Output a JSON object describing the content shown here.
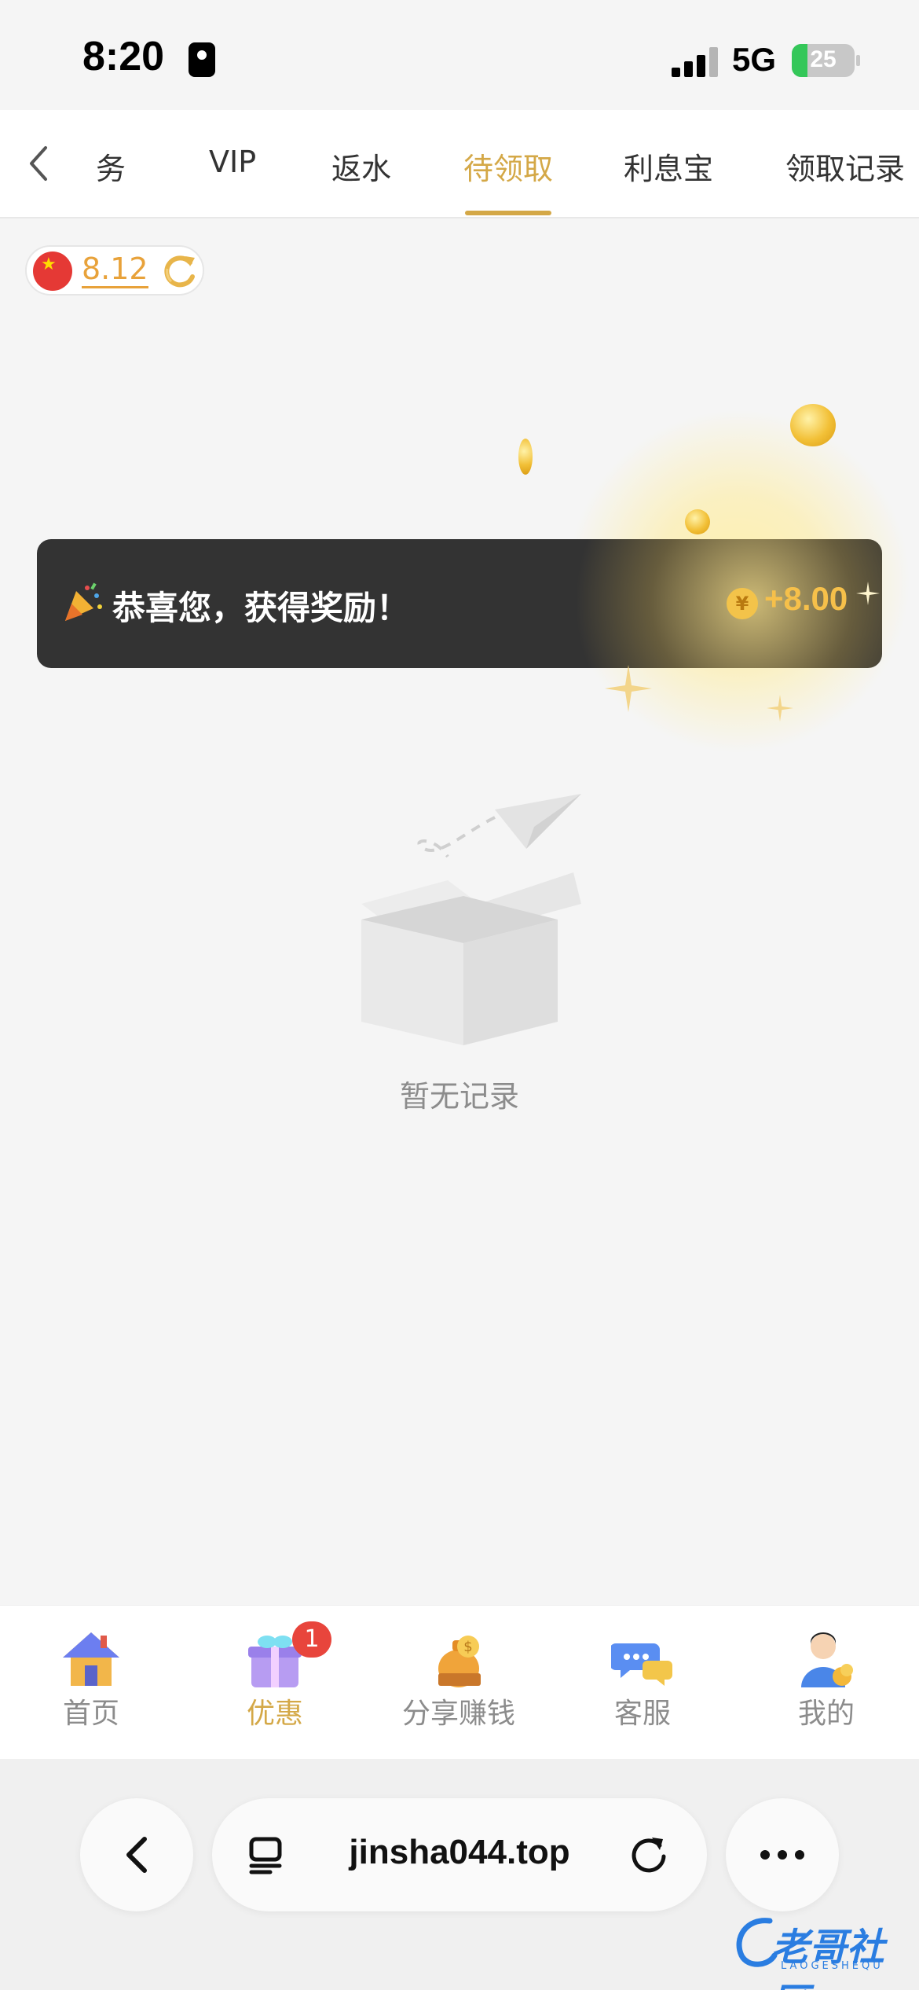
{
  "status_bar": {
    "time": "8:20",
    "network": "5G",
    "battery_level": "25"
  },
  "tabs": [
    {
      "label": "务",
      "active": false
    },
    {
      "label": "VIP",
      "active": false
    },
    {
      "label": "返水",
      "active": false
    },
    {
      "label": "待领取",
      "active": true
    },
    {
      "label": "利息宝",
      "active": false
    },
    {
      "label": "领取记录",
      "active": false
    }
  ],
  "balance": {
    "value": "8.12"
  },
  "toast": {
    "message": "恭喜您，获得奖励！",
    "amount": "+8.00",
    "coin_symbol": "¥"
  },
  "empty_state": {
    "text": "暂无记录"
  },
  "bottom_nav": [
    {
      "label": "首页",
      "icon": "house-icon",
      "active": false
    },
    {
      "label": "优惠",
      "icon": "gift-icon",
      "active": true,
      "badge": "1"
    },
    {
      "label": "分享赚钱",
      "icon": "money-bag-icon",
      "active": false
    },
    {
      "label": "客服",
      "icon": "chat-bubbles-icon",
      "active": false
    },
    {
      "label": "我的",
      "icon": "user-avatar-icon",
      "active": false
    }
  ],
  "browser": {
    "url": "jinsha044.top"
  },
  "watermark": {
    "text": "老哥社区",
    "sub": "LAOGESHEQU"
  },
  "colors": {
    "accent_gold": "#d4a847",
    "balance_orange": "#e8a23a",
    "toast_bg": "#333333",
    "badge_red": "#e8453c"
  }
}
